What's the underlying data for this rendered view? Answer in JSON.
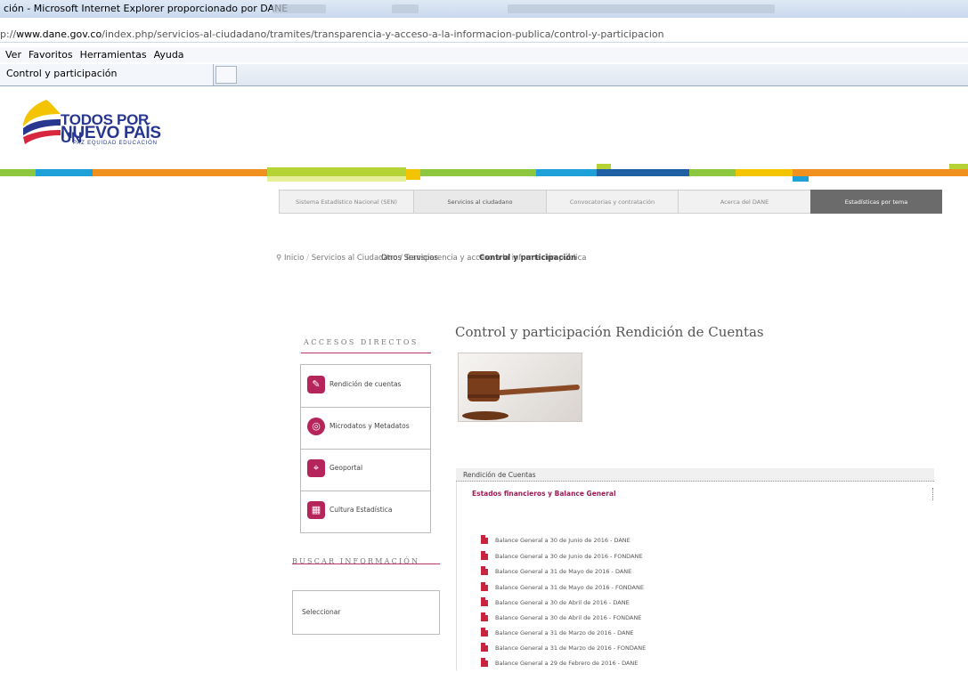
{
  "browser": {
    "window_title": "ción - Microsoft Internet Explorer proporcionado por DANE",
    "address": {
      "prefix": "p://",
      "domain": "www.dane.gov.co",
      "path": "/index.php/servicios-al-ciudadano/tramites/transparencia-y-acceso-a-la-informacion-publica/control-y-participacion"
    },
    "menu": [
      "Ver",
      "Favoritos",
      "Herramientas",
      "Ayuda"
    ],
    "tab_title": "Control y participación"
  },
  "logo": {
    "line1": "TODOS POR UN",
    "line2": "NUEVO PAÍS",
    "tagline": "PAZ   EQUIDAD   EDUCACIÓN"
  },
  "top_nav": [
    "Sistema Estadístico Nacional (SEN)",
    "Servicios al ciudadano",
    "Convocatorias y contratación",
    "Acerca del DANE",
    "Estadísticas por tema"
  ],
  "breadcrumb": {
    "home": "Inicio",
    "text": "Servicios al Ciudadano / Transparencia y acceso a la información pública",
    "overlap1": "Otros Servicios",
    "overlap2": "Control y participación"
  },
  "sidebar": {
    "accesos_title": "ACCESOS DIRECTOS",
    "items": [
      {
        "label": "Rendición de cuentas",
        "icon": "rendicion-icon"
      },
      {
        "label": "Microdatos y Metadatos",
        "icon": "microdatos-icon"
      },
      {
        "label": "Geoportal",
        "icon": "geoportal-icon"
      },
      {
        "label": "Cultura Estadística",
        "icon": "cultura-icon"
      }
    ],
    "buscar_title": "BUSCAR INFORMACIÓN",
    "select_label": "Seleccionar"
  },
  "main": {
    "title": "Control y participación Rendición de Cuentas",
    "panel_header": "Rendición de Cuentas",
    "panel_subtitle": "Estados financieros y Balance General",
    "documents": [
      "Balance General a 30 de Junio de 2016 - DANE",
      "Balance General a 30 de Junio de 2016 - FONDANE",
      "Balance General a 31 de Mayo de 2016 - DANE",
      "Balance General a 31 de Mayo de 2016 - FONDANE",
      "Balance General a 30 de Abril de 2016 - DANE",
      "Balance General a 30 de Abril de 2016 - FONDANE",
      "Balance General a 31 de Marzo de 2016 - DANE",
      "Balance General a 31 de Marzo de 2016 - FONDANE",
      "Balance General a 29 de Febrero de 2016 - DANE"
    ]
  },
  "colors": {
    "brand_magenta": "#b5255b",
    "logo_blue": "#27378f",
    "nav_dark": "#6b6b6b"
  }
}
